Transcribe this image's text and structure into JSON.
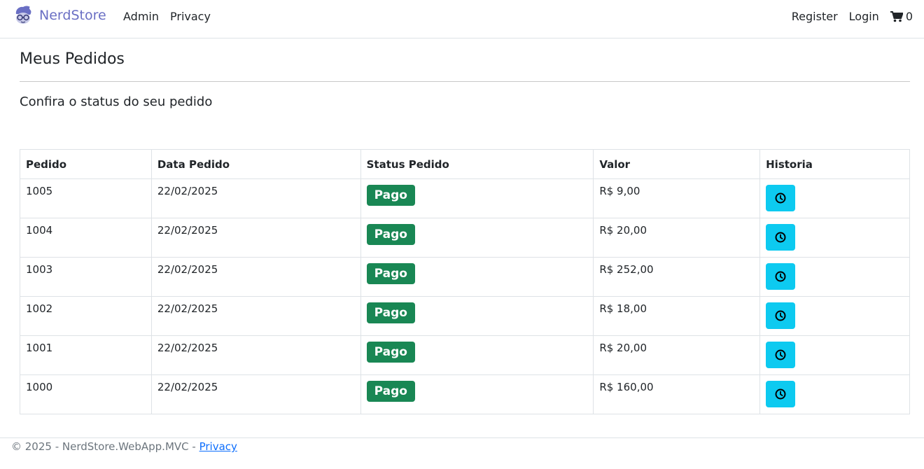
{
  "navbar": {
    "brand": "NerdStore",
    "links": [
      "Admin",
      "Privacy"
    ],
    "register": "Register",
    "login": "Login",
    "cart_count": "0"
  },
  "main": {
    "title": "Meus Pedidos",
    "subtitle": "Confira o status do seu pedido"
  },
  "table": {
    "headers": [
      "Pedido",
      "Data Pedido",
      "Status Pedido",
      "Valor",
      "Historia"
    ],
    "rows": [
      {
        "pedido": "1005",
        "data": "22/02/2025",
        "status": "Pago",
        "valor": "R$ 9,00"
      },
      {
        "pedido": "1004",
        "data": "22/02/2025",
        "status": "Pago",
        "valor": "R$ 20,00"
      },
      {
        "pedido": "1003",
        "data": "22/02/2025",
        "status": "Pago",
        "valor": "R$ 252,00"
      },
      {
        "pedido": "1002",
        "data": "22/02/2025",
        "status": "Pago",
        "valor": "R$ 18,00"
      },
      {
        "pedido": "1001",
        "data": "22/02/2025",
        "status": "Pago",
        "valor": "R$ 20,00"
      },
      {
        "pedido": "1000",
        "data": "22/02/2025",
        "status": "Pago",
        "valor": "R$ 160,00"
      }
    ],
    "history_icon": "clock-icon"
  },
  "footer": {
    "text": "© 2025 - NerdStore.WebApp.MVC - ",
    "privacy_link": "Privacy"
  },
  "colors": {
    "brand": "#6a6fc4",
    "badge_success": "#198754",
    "history_button": "#0dcaf0",
    "link": "#0d6efd"
  }
}
